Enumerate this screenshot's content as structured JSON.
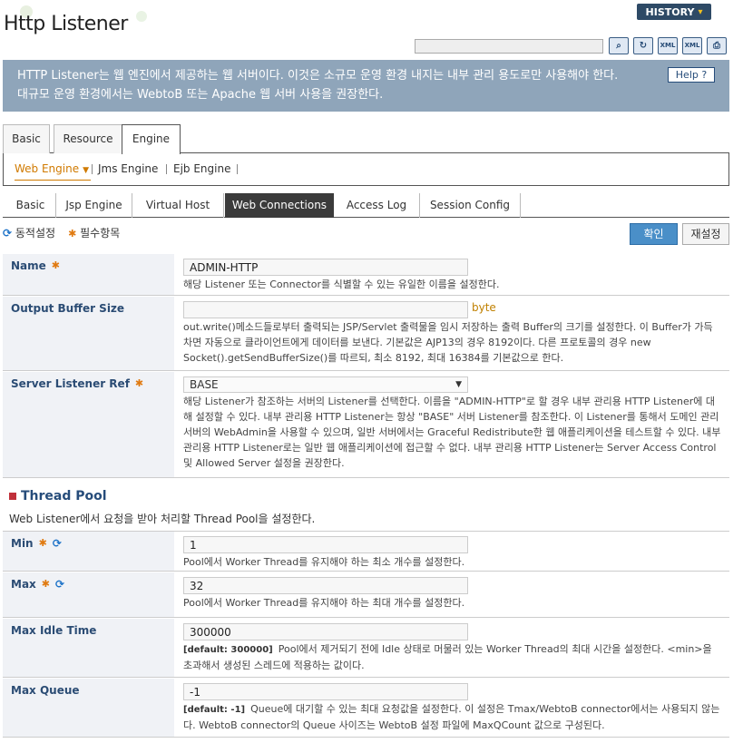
{
  "page": {
    "title": "Http Listener",
    "history_label": "HISTORY",
    "search_value": "",
    "banner_text": "HTTP Listener는 웹 엔진에서 제공하는 웹 서버이다. 이것은 소규모 운영 환경 내지는 내부 관리 용도로만 사용해야 한다. 대규모 운영 환경에서는 WebtoB 또는 Apache 웹 서버 사용을 권장한다.",
    "help_label": "Help ?"
  },
  "toolbar": {
    "icons": [
      "search-icon",
      "refresh-icon",
      "xml-export-icon",
      "xml-import-icon",
      "print-icon"
    ],
    "xml_label": "XML"
  },
  "tabs": {
    "main": [
      "Basic",
      "Resource",
      "Engine"
    ],
    "sub": [
      "Web Engine",
      "Jms Engine",
      "Ejb Engine"
    ],
    "web": [
      "Basic",
      "Jsp Engine",
      "Virtual Host",
      "Web Connections",
      "Access Log",
      "Session Config"
    ]
  },
  "legend": {
    "dynamic": "동적설정",
    "required": "필수항목"
  },
  "actions": {
    "ok": "확인",
    "reset": "재설정"
  },
  "fields": {
    "name": {
      "label": "Name",
      "value": "ADMIN-HTTP",
      "desc": "해당 Listener 또는 Connector를 식별할 수 있는 유일한 이름을 설정한다."
    },
    "output_buffer": {
      "label": "Output Buffer Size",
      "value": "",
      "unit": "byte",
      "desc": "out.write()메소드들로부터 출력되는 JSP/Servlet 출력물을 임시 저장하는 출력 Buffer의 크기를 설정한다. 이 Buffer가 가득 차면 자동으로 클라이언트에게 데이터를 보낸다. 기본값은 AJP13의 경우 8192이다. 다른 프로토콜의 경우 new Socket().getSendBufferSize()를 따르되, 최소 8192, 최대 16384를 기본값으로 한다."
    },
    "server_listener_ref": {
      "label": "Server Listener Ref",
      "value": "BASE",
      "desc": "해당 Listener가 참조하는 서버의 Listener를 선택한다. 이름을 \"ADMIN-HTTP\"로 할 경우 내부 관리용 HTTP Listener에 대해 설정할 수 있다. 내부 관리용 HTTP Listener는 항상 \"BASE\" 서버 Listener를 참조한다. 이 Listener를 통해서 도메인 관리 서버의 WebAdmin을 사용할 수 있으며, 일반 서버에서는 Graceful Redistribute한 웹 애플리케이션을 테스트할 수 있다. 내부 관리용 HTTP Listener로는 일반 웹 애플리케이션에 접근할 수 없다. 내부 관리용 HTTP Listener는 Server Access Control 및 Allowed Server 설정을 권장한다."
    }
  },
  "thread_pool": {
    "title": "Thread Pool",
    "desc": "Web Listener에서 요청을 받아 처리할 Thread Pool을 설정한다.",
    "min": {
      "label": "Min",
      "value": "1",
      "desc": "Pool에서 Worker Thread를 유지해야 하는 최소 개수를 설정한다."
    },
    "max": {
      "label": "Max",
      "value": "32",
      "desc": "Pool에서 Worker Thread를 유지해야 하는 최대 개수를 설정한다."
    },
    "max_idle_time": {
      "label": "Max Idle Time",
      "value": "300000",
      "default": "[default: 300000]",
      "desc": "Pool에서 제거되기 전에 Idle 상태로 머물러 있는 Worker Thread의 최대 시간을 설정한다. <min>을 초과해서 생성된 스레드에 적용하는 값이다."
    },
    "max_queue": {
      "label": "Max Queue",
      "value": "-1",
      "default": "[default: -1]",
      "desc": "Queue에 대기할 수 있는 최대 요청값을 설정한다. 이 설정은 Tmax/WebtoB connector에서는 사용되지 않는다. WebtoB connector의 Queue 사이즈는 WebtoB 설정 파일에 MaxQCount 값으로 구성된다."
    }
  }
}
